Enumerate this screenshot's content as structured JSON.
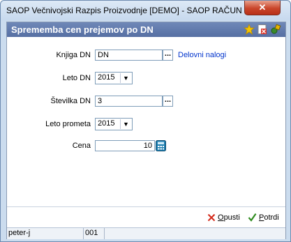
{
  "window": {
    "title": "SAOP  Večnivojski Razpis Proizvodnje [DEMO] - SAOP RAČUNALNIŠ...",
    "close_label": "✕"
  },
  "header": {
    "title": "Sprememba cen prejemov po DN",
    "icons": [
      "star-icon",
      "document-close-icon",
      "tools-icon"
    ]
  },
  "form": {
    "knjiga_dn": {
      "label": "Knjiga DN",
      "value": "DN",
      "link": "Delovni nalogi"
    },
    "leto_dn": {
      "label": "Leto DN",
      "value": "2015"
    },
    "stevilka_dn": {
      "label": "Številka DN",
      "value": "3"
    },
    "leto_prometa": {
      "label": "Leto prometa",
      "value": "2015"
    },
    "cena": {
      "label": "Cena",
      "value": "10"
    }
  },
  "footer": {
    "cancel": {
      "hotkey": "O",
      "rest": "pusti"
    },
    "confirm": {
      "hotkey": "P",
      "rest": "otrdi"
    }
  },
  "status": {
    "user": "peter-j",
    "code": "001"
  },
  "colors": {
    "header_bg": "#5f79ad",
    "link": "#0033cc",
    "cancel_icon": "#d42a1a",
    "confirm_icon": "#2e8b1e"
  }
}
